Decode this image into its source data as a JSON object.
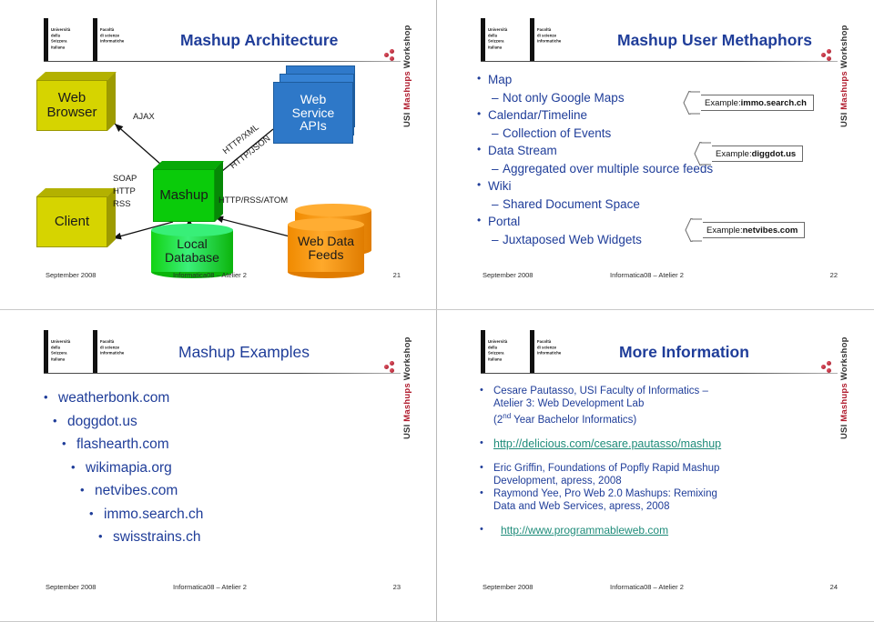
{
  "deck": {
    "logo": {
      "left_lines": [
        "Università",
        "della",
        "Svizzera",
        "italiana"
      ],
      "right_lines": [
        "Facoltà",
        "di scienze",
        "informatiche"
      ]
    },
    "side_brand": {
      "prefix": "USI ",
      "accent": "Mashups",
      "suffix": " Workshop"
    },
    "footer_date": "September 2008",
    "footer_center": "Informatica08 – Atelier 2"
  },
  "slides": [
    {
      "id": "slide-21",
      "title": "Mashup Architecture",
      "page": "21",
      "diagram": {
        "nodes": [
          {
            "name": "web-browser",
            "label": "Web\nBrowser",
            "shape": "cube-yellow"
          },
          {
            "name": "client",
            "label": "Client",
            "shape": "cube-yellow"
          },
          {
            "name": "mashup",
            "label": "Mashup",
            "shape": "cube-green"
          },
          {
            "name": "web-service-apis",
            "label": "Web\nService\nAPIs",
            "shape": "stack-blue"
          },
          {
            "name": "local-database",
            "label": "Local\nDatabase",
            "shape": "cyl-green"
          },
          {
            "name": "web-data-feeds",
            "label": "Web Data\nFeeds",
            "shape": "cyl-orange"
          }
        ],
        "edge_labels": {
          "ajax": "AJAX",
          "http_xml": "HTTP/XML",
          "http_json": "HTTP/JSON",
          "soap": "SOAP",
          "http": "HTTP",
          "rss": "RSS",
          "http_rss_atom": "HTTP/RSS/ATOM"
        }
      }
    },
    {
      "id": "slide-22",
      "title": "Mashup User Methaphors",
      "page": "22",
      "bullets": [
        {
          "level": 1,
          "text": "Map"
        },
        {
          "level": 2,
          "text": "Not only Google Maps"
        },
        {
          "level": 1,
          "text": "Calendar/Timeline"
        },
        {
          "level": 2,
          "text": "Collection of Events"
        },
        {
          "level": 1,
          "text": "Data Stream"
        },
        {
          "level": 2,
          "text": "Aggregated over multiple source feeds"
        },
        {
          "level": 1,
          "text": "Wiki"
        },
        {
          "level": 2,
          "text": "Shared Document Space"
        },
        {
          "level": 1,
          "text": "Portal"
        },
        {
          "level": 2,
          "text": "Juxtaposed Web Widgets"
        }
      ],
      "callouts": [
        {
          "name": "callout-immo",
          "prefix": "Example: ",
          "value": "immo.search.ch"
        },
        {
          "name": "callout-diggdot",
          "prefix": "Example: ",
          "value": "diggdot.us"
        },
        {
          "name": "callout-netvibes",
          "prefix": "Example: ",
          "value": "netvibes.com"
        }
      ]
    },
    {
      "id": "slide-23",
      "title": "Mashup Examples",
      "page": "23",
      "items": [
        "weatherbonk.com",
        "doggdot.us",
        "flashearth.com",
        "wikimapia.org",
        "netvibes.com",
        "immo.search.ch",
        "swisstrains.ch"
      ]
    },
    {
      "id": "slide-24",
      "title": "More Information",
      "page": "24",
      "items": {
        "author_line1": "Cesare Pautasso, USI Faculty of Informatics –",
        "author_line2": "Atelier 3: Web Development Lab",
        "author_line3_pre": "(2",
        "author_line3_sup": "nd",
        "author_line3_post": " Year Bachelor Informatics)",
        "link1": "http://delicious.com/cesare.pautasso/mashup",
        "ref1_line1": "Eric Griffin, Foundations of Popfly Rapid Mashup",
        "ref1_line2": "Development, apress, 2008",
        "ref2_line1": "Raymond Yee, Pro Web 2.0 Mashups: Remixing",
        "ref2_line2": "Data and Web Services, apress, 2008",
        "link2": "http://www.programmableweb.com"
      }
    }
  ],
  "colors": {
    "title_blue": "#1F3D99",
    "body_blue": "#1F3D99",
    "link_teal": "#1F8C7A",
    "brand_red": "#B01C2E",
    "cube_yellow": "#D6D400",
    "cube_green": "#0ACB0A",
    "stack_blue": "#2E78C8",
    "cyl_green": "#12D312",
    "cyl_orange": "#F08A00"
  }
}
